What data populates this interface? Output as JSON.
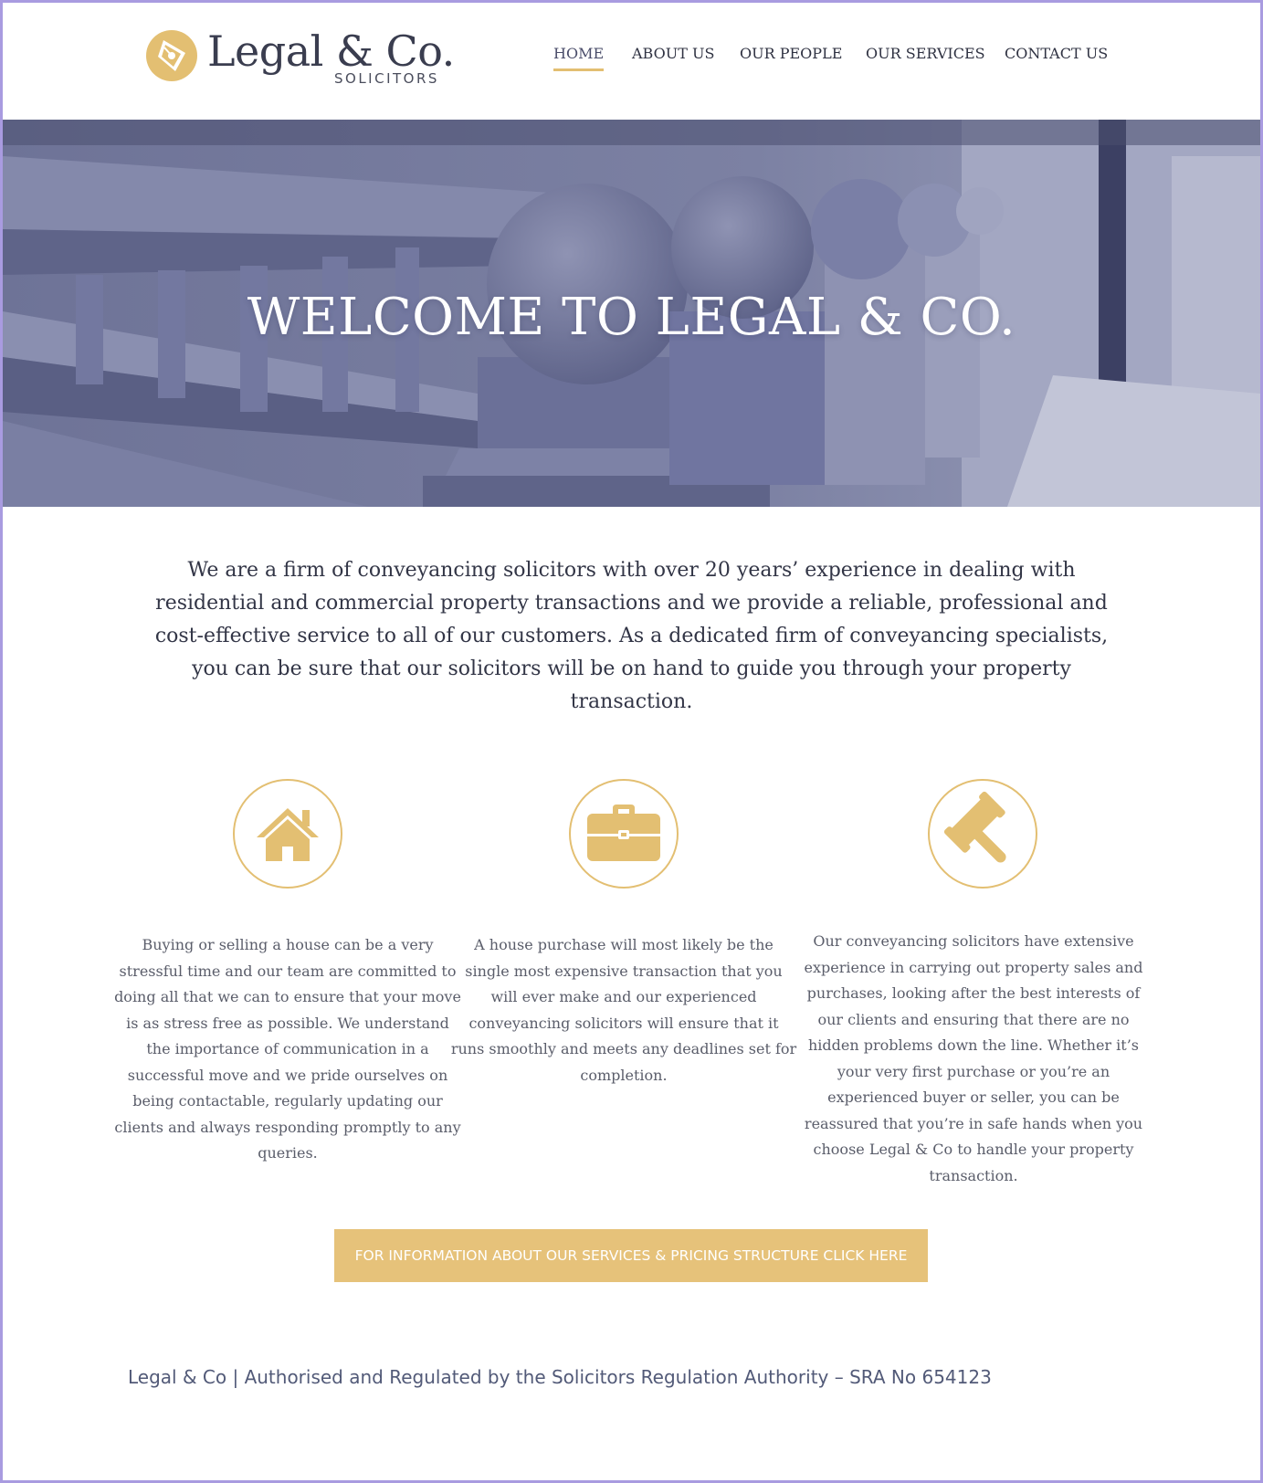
{
  "brand": {
    "name": "Legal & Co.",
    "tagline": "SOLICITORS",
    "accent_color": "#e3bf72",
    "logo_icon": "pen-nib-icon"
  },
  "nav": {
    "items": [
      {
        "label": "HOME",
        "active": true
      },
      {
        "label": "ABOUT US",
        "active": false
      },
      {
        "label": "OUR PEOPLE",
        "active": false
      },
      {
        "label": "OUR SERVICES",
        "active": false
      },
      {
        "label": "CONTACT US",
        "active": false
      }
    ]
  },
  "hero": {
    "title": "WELCOME TO LEGAL & CO.",
    "overlay_color": "#6b7099"
  },
  "intro": {
    "text": "We are a firm of conveyancing solicitors with over 20 years’ experience in dealing with residential and commercial property transactions and we provide a reliable, professional and cost-effective service to all of our customers. As a dedicated firm of conveyancing specialists, you can be sure that our solicitors will be on hand to guide you through your property transaction."
  },
  "features": [
    {
      "icon": "house-icon",
      "text": "Buying or selling a house can be a very stressful time and our team are committed to doing all that we can to ensure that your move is as stress free as possible. We understand the importance of communication in a successful move and we pride ourselves on being contactable, regularly updating our clients and always responding promptly to any queries."
    },
    {
      "icon": "briefcase-icon",
      "text": "A house purchase will most likely be the single most expensive transaction that you will ever make and our experienced conveyancing solicitors will ensure that it runs smoothly and meets any deadlines set for completion."
    },
    {
      "icon": "gavel-icon",
      "text": "Our conveyancing solicitors have extensive experience in carrying out property sales and purchases, looking after the best interests of our clients and ensuring that there are no hidden problems down the line. Whether it’s your very first purchase or you’re an experienced buyer or seller, you can be reassured that you’re in safe hands when you choose Legal & Co to handle your property transaction."
    }
  ],
  "cta": {
    "label": "FOR INFORMATION ABOUT OUR SERVICES & PRICING STRUCTURE CLICK HERE"
  },
  "footer": {
    "text": "Legal & Co  | Authorised and Regulated by the Solicitors Regulation Authority – SRA No 654123"
  }
}
